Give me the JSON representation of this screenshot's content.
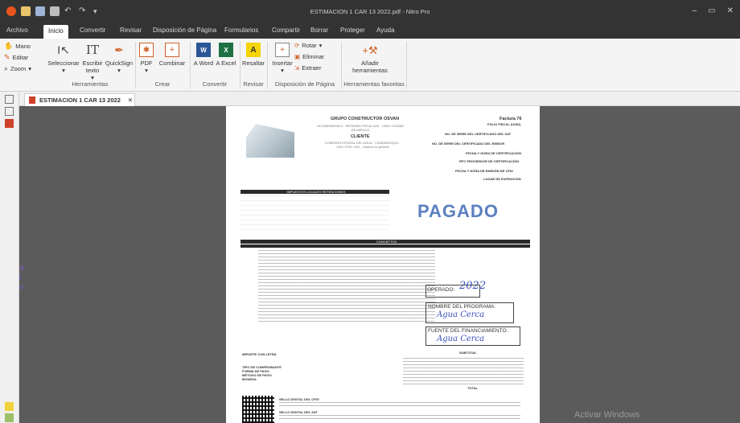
{
  "window": {
    "title": "ESTIMACION 1 CAR 13 2022.pdf - Nitro Pro",
    "controls": [
      "–",
      "▭",
      "✕"
    ]
  },
  "ribbon_tabs": [
    "Archivo",
    "Inicio",
    "Convertir",
    "Revisar",
    "Disposición de Página",
    "Formularios",
    "Compartir",
    "Borrar",
    "Proteger",
    "Ayuda"
  ],
  "ribbon": {
    "mano": "Mano",
    "editar": "Editar",
    "zoom": "Zoom",
    "seleccionar": "Seleccionar",
    "escribir_texto": "Escribir texto",
    "quicksign": "QuickSign",
    "pdf": "PDF",
    "combinar": "Combinar",
    "a_word": "A Word",
    "a_excel": "A Excel",
    "resaltar": "Resaltar",
    "insertar": "Insertar",
    "rotar": "Rotar",
    "eliminar": "Eliminar",
    "extraer": "Extraer",
    "anadir_herramientas": "Añadir herramientas",
    "groups": {
      "herramientas": "Herramientas",
      "crear": "Crear",
      "convertir": "Convertir",
      "revisar": "Revisar",
      "disposicion": "Disposición de Página",
      "favoritas": "Herramientas favoritas"
    }
  },
  "doc_tab": {
    "label": "ESTIMACION 1 CAR 13 2022",
    "close": "✕"
  },
  "watermark": "Activar Windows",
  "bleed_text": [
    "a",
    "l",
    "v"
  ],
  "pdf": {
    "company": "GRUPO CONSTRUCTOR OSVAN",
    "invoice": "Factura 76",
    "invoice_sub": "FOLIO FISCAL (UUID)",
    "cliente": "CLIENTE",
    "cert_emisor": "NO. DE SERIE DEL CERTIFICADO DEL EMISOR",
    "cert_sat": "NO. DE SERIE DEL CERTIFICADO DEL SAT",
    "fecha_cert": "FECHA Y HORA DE CERTIFICACIÓN",
    "rfc_prov": "RFC PROVEEDOR DE CERTIFICACIÓN",
    "fecha_emision": "FECHA Y HORA DE EMISIÓN DE CFDI",
    "lugar": "LUGAR DE EXPEDICIÓN",
    "impuestos_header": "IMPUESTOS LOCALES RETENCIONES",
    "conceptos_header": "CONCEPTOS",
    "pagado": "PAGADO",
    "operado_label": "OPERADO:",
    "operado_hand": "2022",
    "programa_label": "NOMBRE DEL PROGRAMA:",
    "programa_hand": "Agua Cerca",
    "financiamiento_label": "FUENTE DEL FINANCIAMIENTO:",
    "financiamiento_hand": "Agua Cerca",
    "importe_letra": "IMPORTE CON LETRA",
    "tipo_comprobante": "TIPO DE COMPROBANTE",
    "forma_pago": "FORMA DE PAGO",
    "metodo_pago": "MÉTODO DE PAGO",
    "moneda": "MONEDA",
    "subtotal": "SUBTOTAL",
    "total": "TOTAL",
    "sello_cfdi": "SELLO DIGITAL DEL CFDI",
    "sello_sat": "SELLO DIGITAL DEL SAT"
  }
}
